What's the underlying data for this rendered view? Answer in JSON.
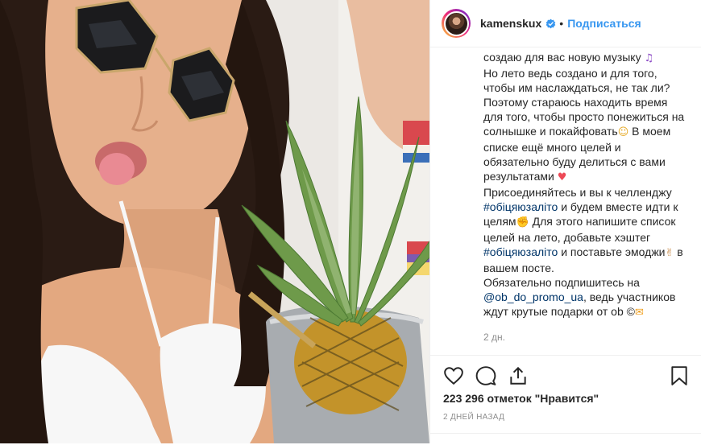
{
  "header": {
    "username": "kamenskux",
    "follow_label": "Подписаться",
    "separator": "•"
  },
  "caption": {
    "line_music": "создаю для вас новую музыку",
    "line_music_emoji": "♫",
    "para1": "Но лето ведь создано и для того, чтобы им наслаждаться, не так ли? Поэтому стараюсь находить время для того, чтобы просто понежиться на солнышке и покайфовать",
    "para1_emoji": "☺",
    "para1_cont": " В моем списке ещё много целей и обязательно буду делиться с вами результатами ",
    "heart_emoji": "♥",
    "para2_a": "Присоединяйтесь и вы к челленджу ",
    "hashtag1": "#обіцяюзаліто",
    "para2_b": " и будем вместе идти к целям",
    "muscle_emoji": "✊",
    "para2_c": " Для этого напишите список целей на лето, добавьте хэштег ",
    "hashtag2": "#обіцяюзаліто",
    "para2_d": " и поставьте эмоджи",
    "ok_emoji": "✌",
    "para2_e": " в вашем посте.",
    "para3_a": "Обязательно подпишитесь на ",
    "mention": "@ob_do_promo_ua",
    "para3_b": ", ведь участников ждут крутые подарки от ob ©",
    "gift_emoji": "✉",
    "time_ago": "2 дн."
  },
  "actions": {
    "like_icon": "heart-outline-icon",
    "comment_icon": "comment-bubble-icon",
    "share_icon": "share-icon",
    "save_icon": "bookmark-icon"
  },
  "likes": "223 296 отметок \"Нравится\"",
  "date": "2 ДНЕЙ НАЗАД",
  "colors": {
    "link": "#3897f0",
    "hashtag": "#003569",
    "muted": "#8e8e8e",
    "border": "#efefef"
  }
}
